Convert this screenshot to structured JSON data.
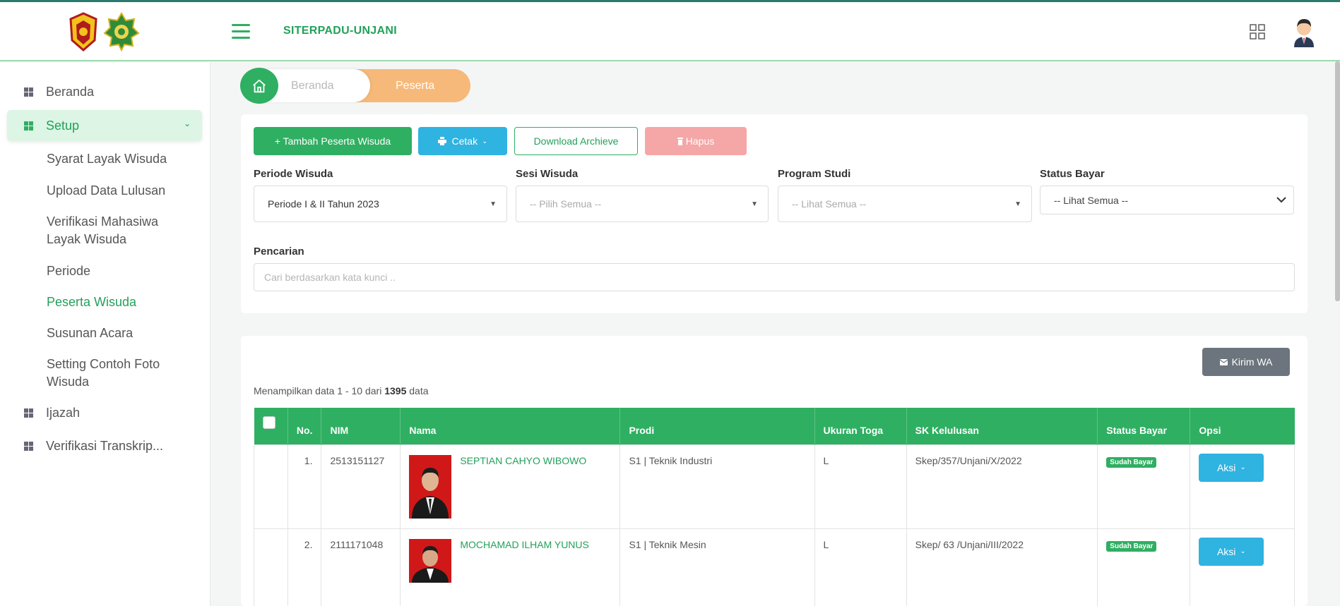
{
  "header": {
    "app_title": "SITERPADU-UNJANI"
  },
  "sidebar": {
    "items": [
      {
        "label": "Beranda",
        "icon": "dashboard-icon"
      },
      {
        "label": "Setup",
        "icon": "dashboard-icon",
        "active": true
      },
      {
        "label": "Ijazah",
        "icon": "dashboard-icon"
      },
      {
        "label": "Verifikasi Transkrip...",
        "icon": "dashboard-icon"
      }
    ],
    "submenu": [
      "Syarat Layak Wisuda",
      "Upload Data Lulusan",
      "Verifikasi Mahasiwa Layak Wisuda",
      "Periode",
      "Peserta Wisuda",
      "Susunan Acara",
      "Setting Contoh Foto Wisuda"
    ]
  },
  "breadcrumb": {
    "home": "Beranda",
    "current": "Peserta Wisuda"
  },
  "toolbar": {
    "tambah": "+ Tambah Peserta Wisuda",
    "cetak": "Cetak",
    "download": "Download Archieve",
    "hapus": "Hapus"
  },
  "filters": {
    "periode_label": "Periode Wisuda",
    "periode_value": "Periode I & II Tahun 2023",
    "sesi_label": "Sesi Wisuda",
    "sesi_value": "-- Pilih Semua --",
    "prodi_label": "Program Studi",
    "prodi_value": "-- Lihat Semua --",
    "status_label": "Status Bayar",
    "status_value": "-- Lihat Semua --",
    "search_label": "Pencarian",
    "search_placeholder": "Cari berdasarkan kata kunci .."
  },
  "table": {
    "kirim_wa": "Kirim WA",
    "summary_prefix": "Menampilkan data 1 - 10 dari",
    "total": "1395",
    "summary_suffix": "data",
    "columns": [
      "No.",
      "NIM",
      "Nama",
      "Prodi",
      "Ukuran Toga",
      "SK Kelulusan",
      "Status Bayar",
      "Opsi"
    ],
    "rows": [
      {
        "no": "1.",
        "nim": "2513151127",
        "nama": "SEPTIAN CAHYO WIBOWO",
        "prodi": "S1 | Teknik Industri",
        "toga": "L",
        "sk": "Skep/357/Unjani/X/2022",
        "status": "Sudah Bayar",
        "aksi": "Aksi"
      },
      {
        "no": "2.",
        "nim": "2111171048",
        "nama": "MOCHAMAD ILHAM YUNUS",
        "prodi": "S1 | Teknik Mesin",
        "toga": "L",
        "sk": "Skep/ 63 /Unjani/III/2022",
        "status": "Sudah Bayar",
        "aksi": "Aksi"
      }
    ]
  },
  "colors": {
    "primary": "#2faf62",
    "info": "#2fb3e0",
    "breadcrumb_active": "#f7b97a",
    "danger_light": "#f5a6a6"
  }
}
